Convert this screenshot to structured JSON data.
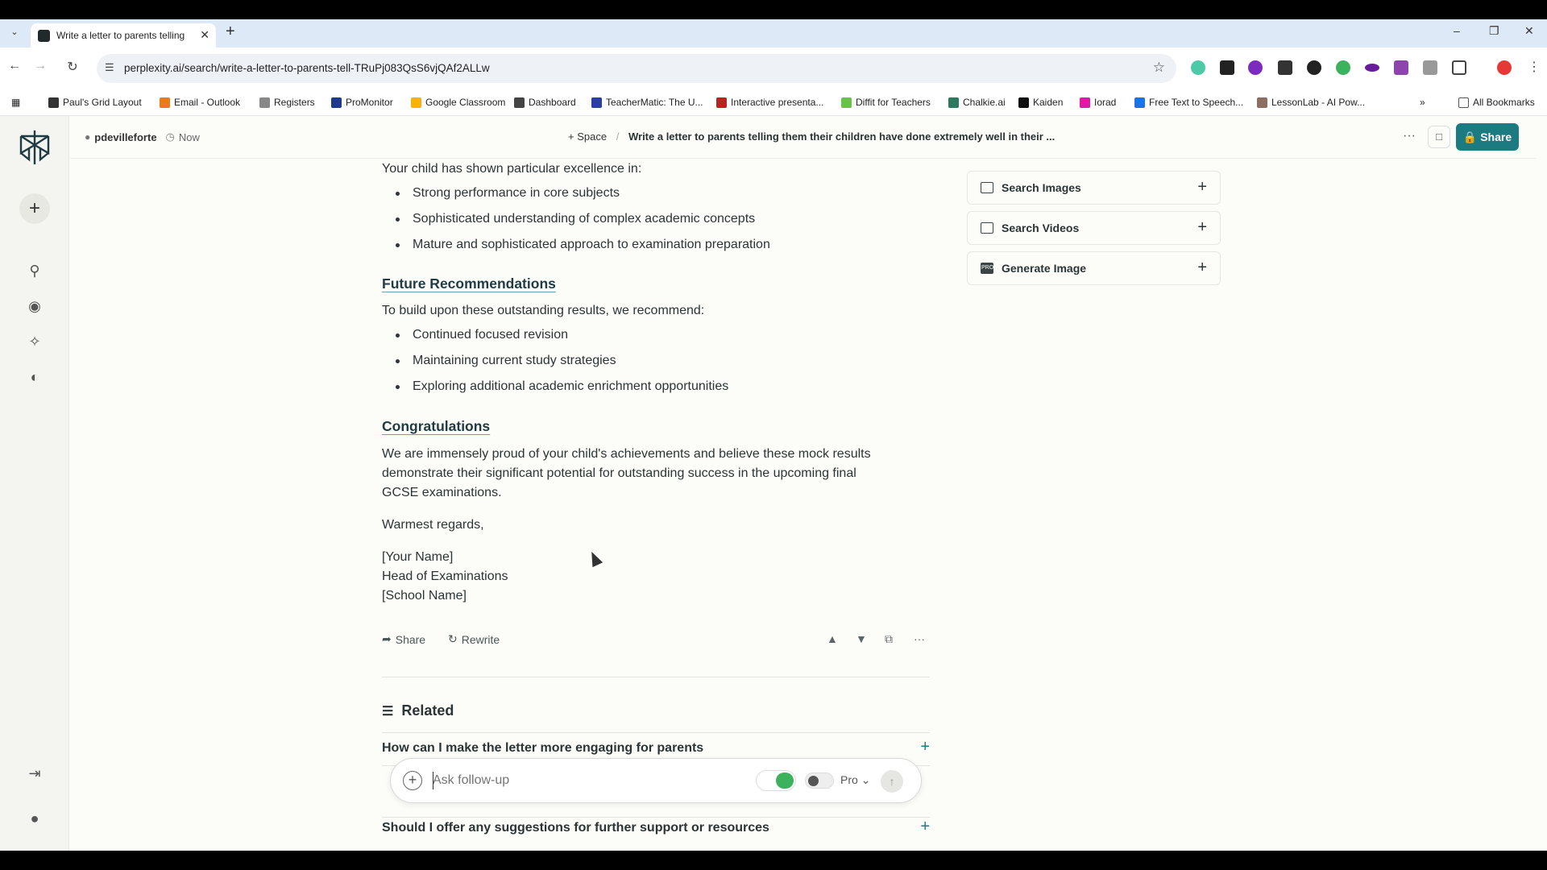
{
  "browser": {
    "tab_title": "Write a letter to parents telling",
    "url": "perplexity.ai/search/write-a-letter-to-parents-tell-TRuPj083QsS6vjQAf2ALLw",
    "bookmarks": [
      {
        "label": "Paul's Grid Layout",
        "color": "#333333"
      },
      {
        "label": "Email - Outlook",
        "color": "#e97c1a"
      },
      {
        "label": "Registers",
        "color": "#888888"
      },
      {
        "label": "ProMonitor",
        "color": "#1e3a8a"
      },
      {
        "label": "Google Classroom",
        "color": "#f4b400"
      },
      {
        "label": "Dashboard",
        "color": "#444444"
      },
      {
        "label": "TeacherMatic: The U...",
        "color": "#2c3e9e"
      },
      {
        "label": "Interactive presenta...",
        "color": "#b3261e"
      },
      {
        "label": "Diffit for Teachers",
        "color": "#6bc04b"
      },
      {
        "label": "Chalkie.ai",
        "color": "#2b7a5b"
      },
      {
        "label": "Kaiden",
        "color": "#111111"
      },
      {
        "label": "Iorad",
        "color": "#e01aa5"
      },
      {
        "label": "Free Text to Speech...",
        "color": "#1a73e8"
      },
      {
        "label": "LessonLab - AI Pow...",
        "color": "#8d6e63"
      }
    ],
    "all_bookmarks": "All Bookmarks"
  },
  "header": {
    "username": "pdevilleforte",
    "time": "Now",
    "space": "Space",
    "thread_title": "Write a letter to parents telling them their children have done extremely well in their ...",
    "share": "Share"
  },
  "letter": {
    "excellence_intro": "Your child has shown particular excellence in:",
    "excellence_items": [
      "Strong performance in core subjects",
      "Sophisticated understanding of complex academic concepts",
      "Mature and sophisticated approach to examination preparation"
    ],
    "future_heading": "Future Recommendations",
    "future_intro": "To build upon these outstanding results, we recommend:",
    "future_items": [
      "Continued focused revision",
      "Maintaining current study strategies",
      "Exploring additional academic enrichment opportunities"
    ],
    "congrats_heading": "Congratulations",
    "congrats_line1": "We are immensely proud of your child's achievements and believe these mock results",
    "congrats_line2": "demonstrate their significant potential for outstanding success in the upcoming final",
    "congrats_line3": "GCSE examinations.",
    "regards": "Warmest regards,",
    "sig_name": "[Your Name]",
    "sig_role": "Head of Examinations",
    "sig_school": "[School Name]"
  },
  "actions": {
    "share": "Share",
    "rewrite": "Rewrite"
  },
  "related": {
    "heading": "Related",
    "items": [
      "How can I make the letter more engaging for parents",
      "Should I offer any suggestions for further support or resources"
    ]
  },
  "followup": {
    "placeholder": "Ask follow-up",
    "mode": "Pro"
  },
  "right_panel": [
    {
      "label": "Search Images"
    },
    {
      "label": "Search Videos"
    },
    {
      "label": "Generate Image"
    }
  ]
}
